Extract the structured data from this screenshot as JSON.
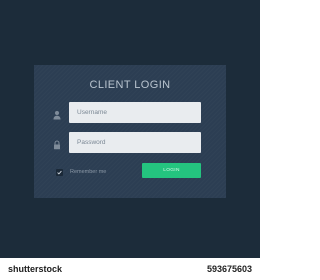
{
  "login": {
    "title": "CLIENT LOGIN",
    "username_placeholder": "Username",
    "password_placeholder": "Password",
    "remember_label": "Remember me",
    "remember_checked": true,
    "button_label": "LOGIN"
  },
  "watermark": {
    "logo": "shutterstock",
    "image_id": "593675603",
    "id_label": "593675603"
  },
  "colors": {
    "background": "#1c2c3a",
    "card": "#2c3e53",
    "accent": "#24c47f",
    "input": "#e9ecef"
  },
  "icons": [
    "user-icon",
    "lock-icon",
    "check-icon"
  ]
}
